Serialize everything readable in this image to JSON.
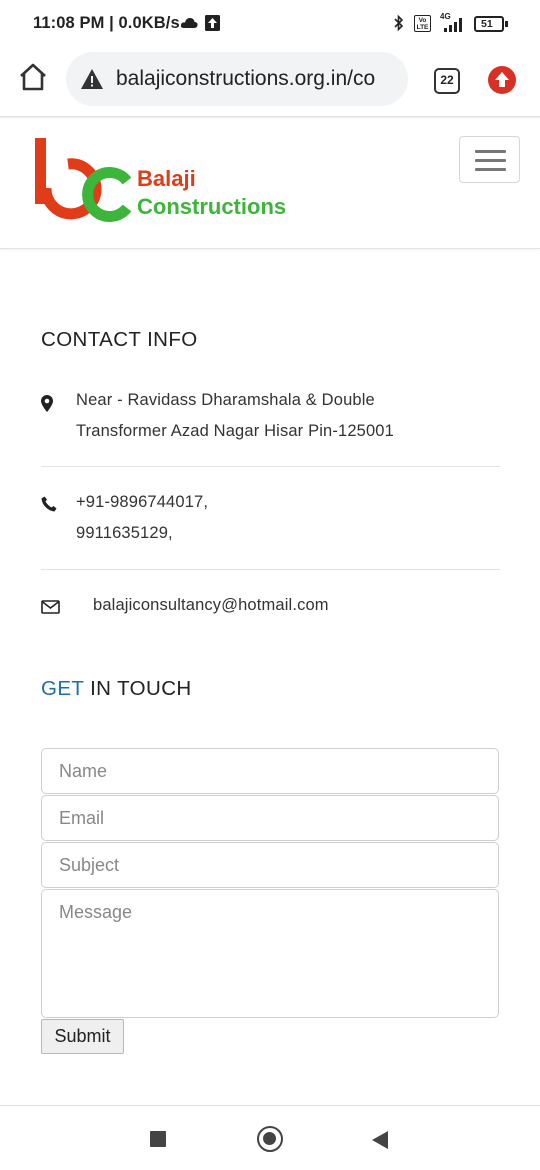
{
  "status_bar": {
    "time": "11:08 PM | 0.0KB/s",
    "network": "4G",
    "volte": "Vo LTE",
    "battery": "51"
  },
  "browser": {
    "url": "balajiconstructions.org.in/co",
    "tab_count": "22"
  },
  "header": {
    "logo_line1": "Balaji",
    "logo_line2": "Constructions",
    "logo_colors": {
      "b": "#e03c1a",
      "c": "#3db53a"
    }
  },
  "contact_info": {
    "title": "CONTACT INFO",
    "address_line1": "Near - Ravidass Dharamshala & Double",
    "address_line2": "Transformer Azad Nagar Hisar Pin-125001",
    "phone_line1": "+91-9896744017,",
    "phone_line2": "9911635129,",
    "email": "balajiconsultancy@hotmail.com",
    "icons": [
      "map-marker-icon",
      "phone-icon",
      "envelope-icon"
    ]
  },
  "get_in_touch": {
    "title_accent": "GET",
    "title_rest": " IN TOUCH",
    "accent_color": "#1d6fa5"
  },
  "form": {
    "name_placeholder": "Name",
    "email_placeholder": "Email",
    "subject_placeholder": "Subject",
    "message_placeholder": "Message",
    "submit_label": "Submit"
  }
}
